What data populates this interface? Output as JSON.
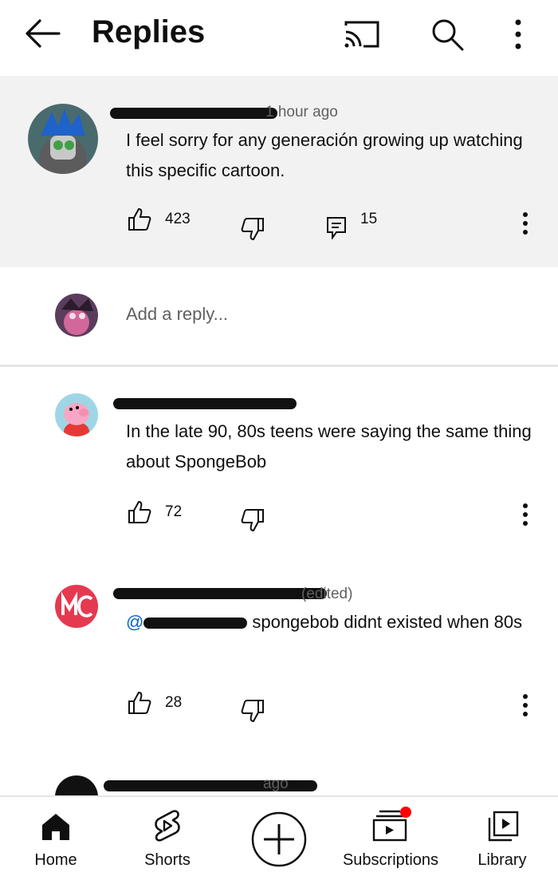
{
  "header": {
    "title": "Replies"
  },
  "parent_comment": {
    "meta": "1 hour ago",
    "text": "I feel sorry for any generación growing up watching this specific cartoon.",
    "likes": "423",
    "replies": "15"
  },
  "reply_box": {
    "placeholder": "Add a reply..."
  },
  "replies": [
    {
      "meta": "",
      "text": "In the late 90, 80s teens were saying the same thing about SpongeBob",
      "likes": "72"
    },
    {
      "meta": "(edited)",
      "mention": "@",
      "text": "spongebob didnt existed when 80s",
      "likes": "28"
    },
    {
      "meta": "ago"
    }
  ],
  "bottom_nav": [
    {
      "label": "Home",
      "icon": "home-icon"
    },
    {
      "label": "Shorts",
      "icon": "shorts-icon"
    },
    {
      "label": "",
      "icon": "create-icon"
    },
    {
      "label": "Subscriptions",
      "icon": "subscriptions-icon"
    },
    {
      "label": "Library",
      "icon": "library-icon"
    }
  ],
  "colors": {
    "accent_red": "#ff0000",
    "link_blue": "#065fd4"
  }
}
